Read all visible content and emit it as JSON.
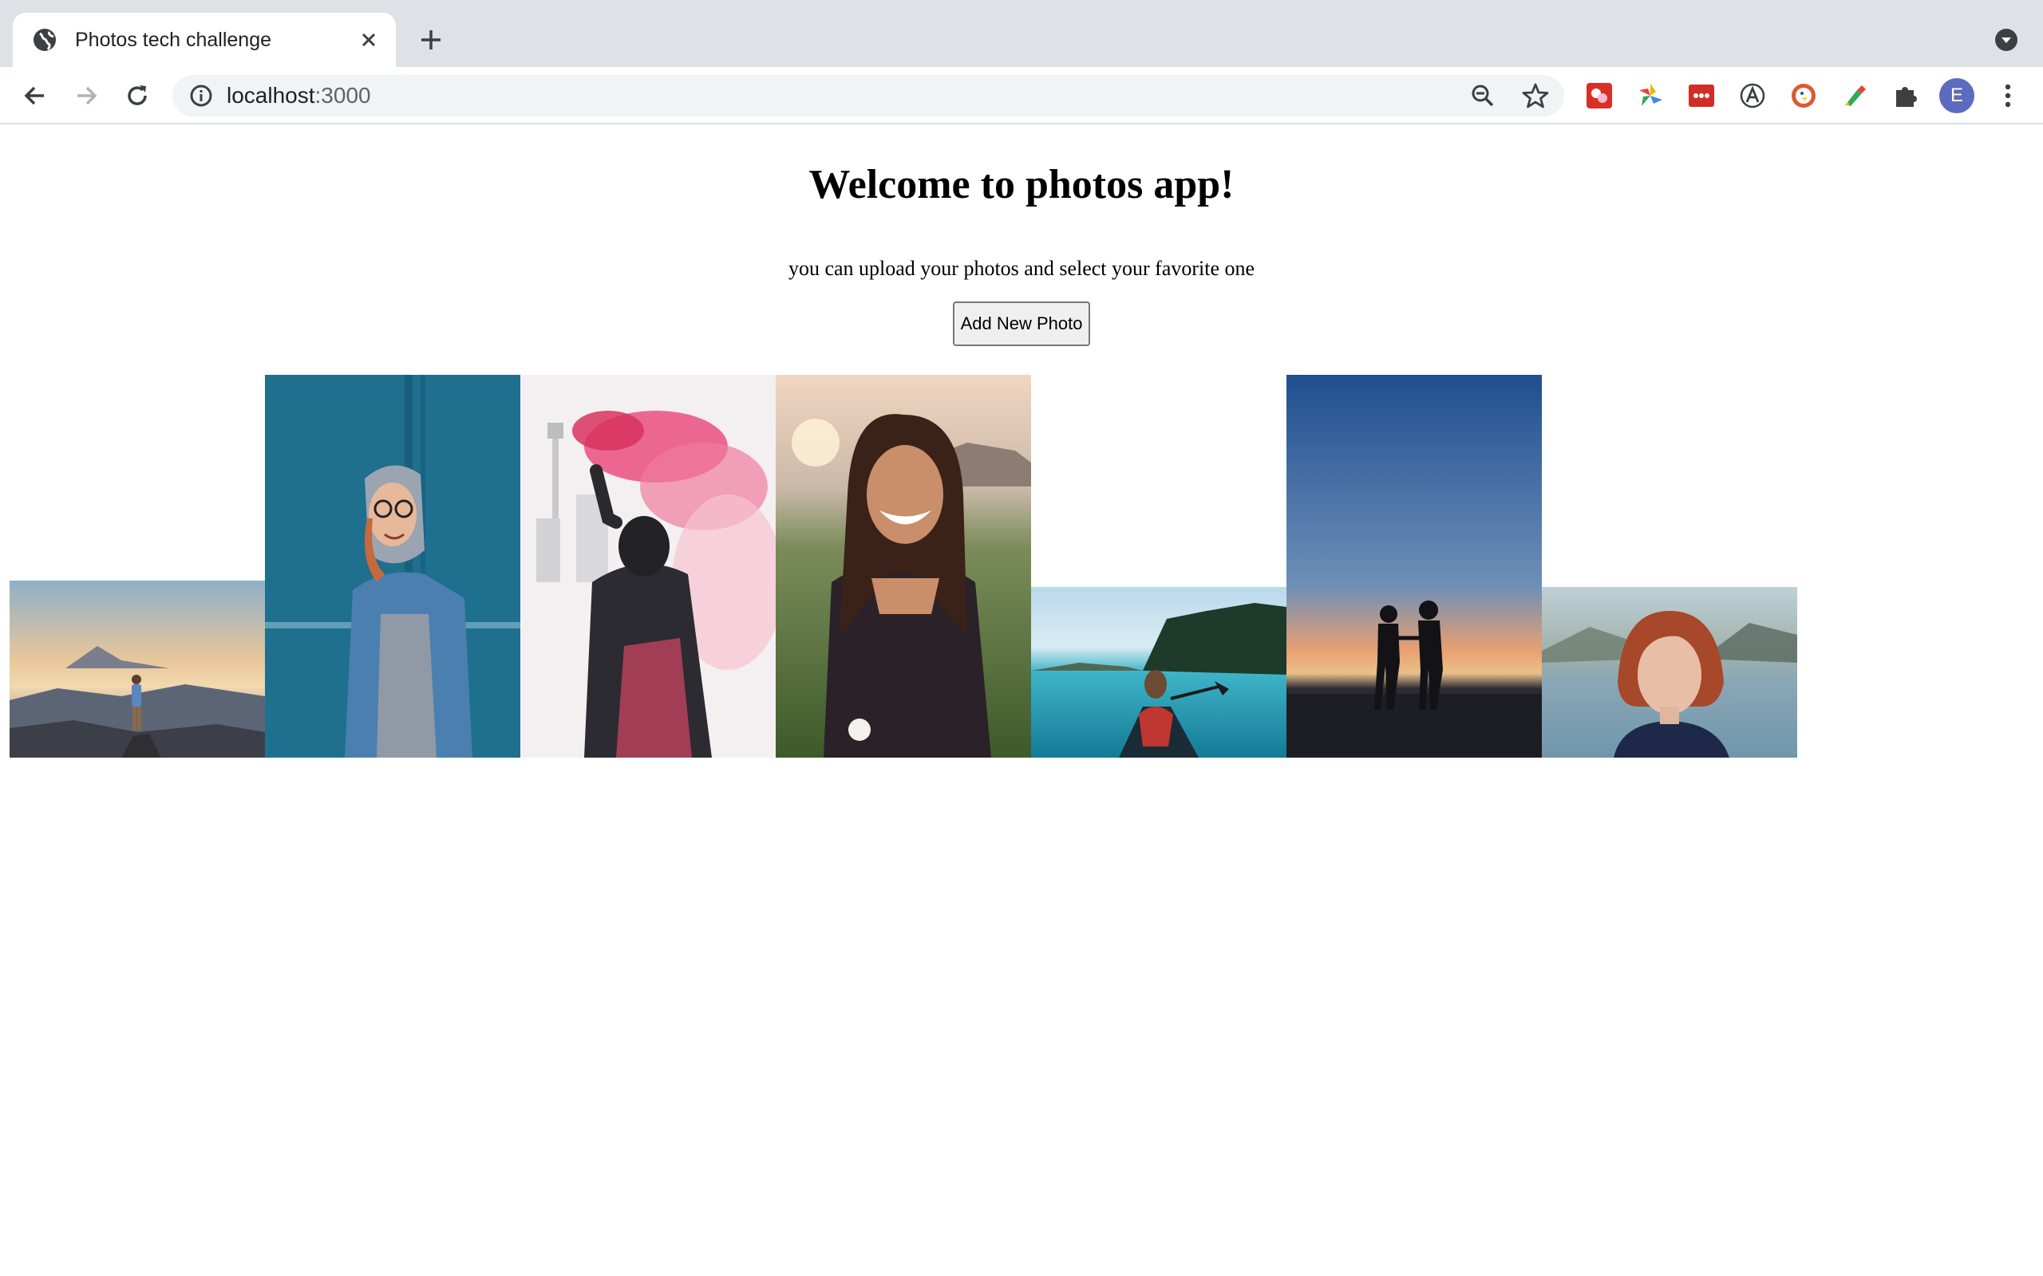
{
  "browser": {
    "tab_title": "Photos tech challenge",
    "url_host": "localhost",
    "url_port": ":3000",
    "profile_initial": "E",
    "icons": {
      "tab_favicon": "globe-icon",
      "tab_close": "close-icon",
      "new_tab": "plus-icon",
      "tab_search": "chevron-down-icon",
      "back": "arrow-left-icon",
      "forward": "arrow-right-icon",
      "reload": "reload-icon",
      "site_info": "info-icon",
      "zoom": "zoom-out-icon",
      "bookmark": "star-icon",
      "extensions": "puzzle-icon",
      "menu": "kebab-menu-icon"
    },
    "extensions": [
      {
        "name": "extension-red-icon",
        "color": "#d93025"
      },
      {
        "name": "extension-pinwheel-icon",
        "color": "#f4b400"
      },
      {
        "name": "extension-lastpass-icon",
        "color": "#d32d27"
      },
      {
        "name": "extension-a-icon",
        "color": "#3c4043"
      },
      {
        "name": "extension-duckduckgo-icon",
        "color": "#de5833"
      },
      {
        "name": "extension-color-picker-icon",
        "color": "#34a853"
      }
    ]
  },
  "page": {
    "heading": "Welcome to photos app!",
    "subtitle": "you can upload your photos and select your favorite one",
    "add_button": "Add New Photo"
  },
  "photos": [
    {
      "name": "photo-mountain-sunset",
      "description": "hiker on mountain peak at sunset"
    },
    {
      "name": "photo-woman-denim-jacket",
      "description": "woman in hoodie and denim jacket by blue wall"
    },
    {
      "name": "photo-smoke-flare",
      "description": "person holding pink smoke flare in city"
    },
    {
      "name": "photo-smiling-woman",
      "description": "smiling woman in field at sunset"
    },
    {
      "name": "photo-canoe-lake",
      "description": "woman paddling canoe on turquoise lake"
    },
    {
      "name": "photo-couple-silhouette",
      "description": "couple silhouette at dusk"
    },
    {
      "name": "photo-redhead-portrait",
      "description": "portrait of red-haired woman by lake"
    }
  ]
}
